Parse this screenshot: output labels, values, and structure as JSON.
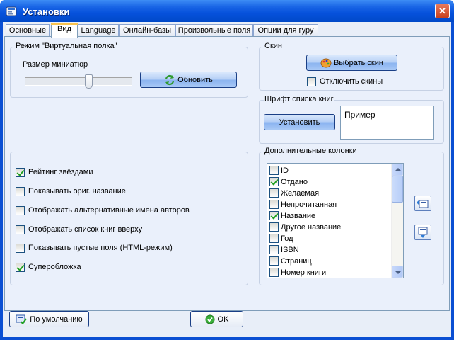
{
  "window": {
    "title": "Установки",
    "close_glyph": "✕",
    "icon": "settings-app-icon"
  },
  "tabs": [
    {
      "label": "Основные",
      "active": false
    },
    {
      "label": "Вид",
      "active": true
    },
    {
      "label": "Language",
      "active": false
    },
    {
      "label": "Онлайн-базы",
      "active": false
    },
    {
      "label": "Произвольные поля",
      "active": false
    },
    {
      "label": "Опции для гуру",
      "active": false
    }
  ],
  "virtual_shelf": {
    "title": "Режим \"Виртуальная полка\"",
    "thumb_size_label": "Размер миниатюр",
    "thumb_size_level": 0.6,
    "refresh_button": "Обновить"
  },
  "skin": {
    "title": "Скин",
    "choose_button": "Выбрать скин",
    "disable_label": "Отключить скины",
    "disable_checked": false
  },
  "font": {
    "title": "Шрифт списка книг",
    "set_button": "Установить",
    "preview_text": "Пример"
  },
  "options": [
    {
      "label": "Рейтинг звёздами",
      "checked": true
    },
    {
      "label": "Показывать ориг. название",
      "checked": false
    },
    {
      "label": "Отображать альтернативные имена авторов",
      "checked": false
    },
    {
      "label": "Отображать список книг вверху",
      "checked": false
    },
    {
      "label": "Показывать пустые поля (HTML-режим)",
      "checked": false
    },
    {
      "label": "Суперобложка",
      "checked": true
    }
  ],
  "extra_columns": {
    "title": "Дополнительные колонки",
    "items": [
      {
        "label": "ID",
        "checked": false
      },
      {
        "label": "Отдано",
        "checked": true
      },
      {
        "label": "Желаемая",
        "checked": false
      },
      {
        "label": "Непрочитанная",
        "checked": false
      },
      {
        "label": "Название",
        "checked": true
      },
      {
        "label": "Другое название",
        "checked": false
      },
      {
        "label": "Год",
        "checked": false
      },
      {
        "label": "ISBN",
        "checked": false
      },
      {
        "label": "Страниц",
        "checked": false
      },
      {
        "label": "Номер книги",
        "checked": false
      }
    ]
  },
  "footer": {
    "default_button": "По умолчанию",
    "ok_button": "OK"
  },
  "colors": {
    "titlebar": "#0a4fd3",
    "check": "#21a121",
    "panel": "#eaf0fb"
  }
}
